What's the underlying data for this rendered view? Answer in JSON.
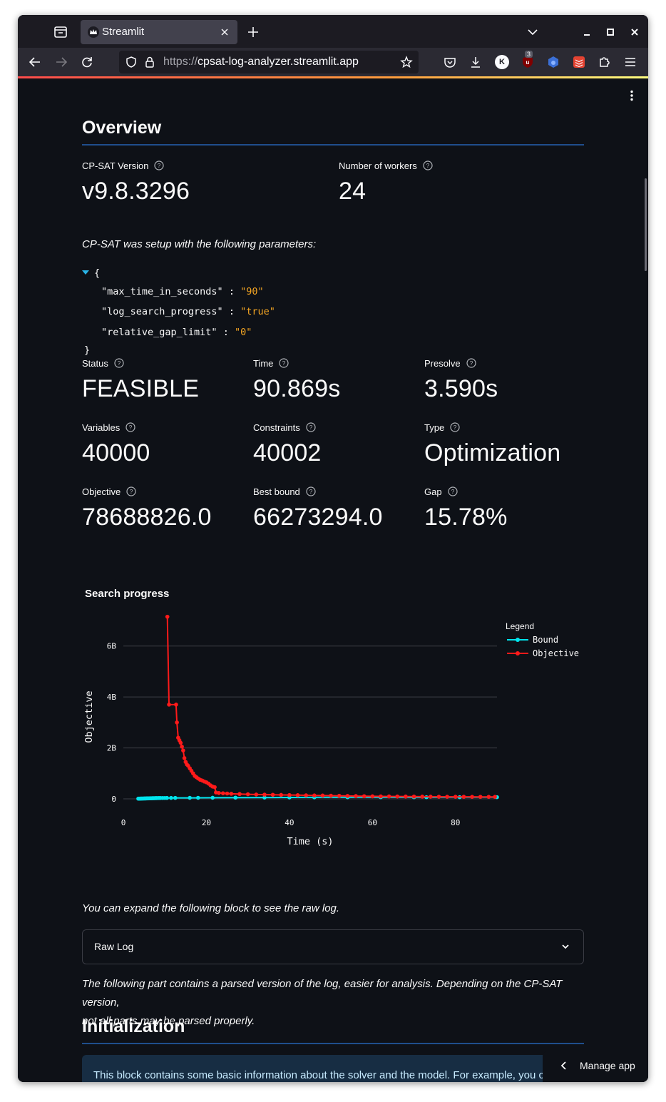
{
  "browser": {
    "tab_title": "Streamlit",
    "url_protocol": "https://",
    "url_host": "cpsat-log-analyzer.streamlit.app",
    "extension_badge": "3",
    "extension_avatar_letter": "K"
  },
  "overview": {
    "heading": "Overview",
    "version_label": "CP-SAT Version",
    "version_value": "v9.8.3296",
    "workers_label": "Number of workers",
    "workers_value": "24",
    "params_intro": "CP-SAT was setup with the following parameters:",
    "params": [
      {
        "key": "\"max_time_in_seconds\"",
        "value": "\"90\""
      },
      {
        "key": "\"log_search_progress\"",
        "value": "\"true\""
      },
      {
        "key": "\"relative_gap_limit\"",
        "value": "\"0\""
      }
    ],
    "metrics": [
      {
        "label": "Status",
        "value": "FEASIBLE"
      },
      {
        "label": "Time",
        "value": "90.869s"
      },
      {
        "label": "Presolve",
        "value": "3.590s"
      },
      {
        "label": "Variables",
        "value": "40000"
      },
      {
        "label": "Constraints",
        "value": "40002"
      },
      {
        "label": "Type",
        "value": "Optimization"
      },
      {
        "label": "Objective",
        "value": "78688826.0"
      },
      {
        "label": "Best bound",
        "value": "66273294.0"
      },
      {
        "label": "Gap",
        "value": "15.78%"
      }
    ]
  },
  "search_progress": {
    "title": "Search progress"
  },
  "chart_data": {
    "type": "line",
    "xlabel": "Time (s)",
    "ylabel": "Objective",
    "xlim": [
      0,
      90
    ],
    "ylim": [
      0,
      7000000000
    ],
    "x_ticks": [
      0,
      20,
      40,
      60,
      80
    ],
    "x_tick_labels": [
      "0",
      "20",
      "40",
      "60",
      "80"
    ],
    "y_ticks": [
      0,
      2000000000,
      4000000000,
      6000000000
    ],
    "y_tick_labels": [
      "0",
      "2B",
      "4B",
      "6B"
    ],
    "legend_title": "Legend",
    "legend_position": "top-right",
    "grid": true,
    "series": [
      {
        "name": "Bound",
        "color": "#00e5ee",
        "x": [
          3.6,
          3.8,
          4.0,
          4.2,
          4.4,
          4.6,
          4.8,
          5.0,
          5.2,
          5.4,
          5.6,
          5.8,
          6.0,
          6.2,
          6.4,
          6.6,
          6.8,
          7.0,
          7.2,
          7.4,
          7.6,
          7.8,
          8.0,
          8.3,
          8.6,
          9.0,
          9.5,
          10.0,
          10.5,
          11.5,
          12.5,
          16.0,
          18.0,
          21.5,
          27.0,
          34.0,
          40.0,
          46.0,
          54.0,
          62.0,
          70.0,
          73.0,
          81.0,
          90.0
        ],
        "y": [
          8000000,
          9000000,
          10000000,
          11000000,
          12000000,
          13000000,
          14000000,
          15000000,
          16000000,
          17000000,
          18000000,
          19000000,
          20000000,
          21000000,
          22000000,
          23000000,
          24000000,
          25000000,
          26000000,
          27000000,
          28000000,
          29000000,
          30000000,
          31000000,
          32000000,
          33000000,
          34000000,
          35000000,
          36000000,
          37000000,
          38000000,
          40000000,
          42000000,
          44000000,
          48000000,
          52000000,
          55000000,
          58000000,
          61000000,
          63000000,
          64000000,
          65000000,
          66000000,
          66273294
        ]
      },
      {
        "name": "Objective",
        "color": "#ff1a1a",
        "x": [
          10.6,
          11.0,
          12.7,
          12.9,
          13.2,
          13.5,
          13.8,
          14.1,
          14.4,
          14.7,
          15.0,
          15.3,
          15.6,
          16.0,
          16.4,
          16.8,
          17.2,
          17.6,
          18.0,
          18.5,
          19.0,
          19.5,
          20.0,
          20.5,
          21.0,
          21.5,
          22.0,
          22.3,
          23.0,
          24.0,
          25.0,
          26.0,
          28.0,
          30.0,
          32.0,
          34.0,
          36.0,
          38.0,
          40.0,
          42.0,
          44.0,
          46.0,
          48.0,
          50.0,
          52.0,
          54.0,
          56.0,
          58.0,
          60.0,
          62.0,
          64.0,
          66.0,
          68.0,
          70.0,
          72.0,
          74.0,
          76.0,
          78.0,
          80.0,
          82.0,
          84.0,
          86.0,
          88.0,
          89.5
        ],
        "y": [
          7150000000,
          3700000000,
          3700000000,
          3000000000,
          2400000000,
          2300000000,
          2200000000,
          2050000000,
          1900000000,
          1600000000,
          1450000000,
          1350000000,
          1300000000,
          1200000000,
          1100000000,
          1000000000,
          900000000,
          850000000,
          800000000,
          750000000,
          720000000,
          680000000,
          650000000,
          600000000,
          530000000,
          480000000,
          460000000,
          250000000,
          230000000,
          220000000,
          210000000,
          200000000,
          190000000,
          180000000,
          170000000,
          165000000,
          160000000,
          155000000,
          150000000,
          145000000,
          140000000,
          135000000,
          130000000,
          125000000,
          120000000,
          115000000,
          110000000,
          105000000,
          100000000,
          98000000,
          96000000,
          94000000,
          92000000,
          90000000,
          88000000,
          86000000,
          84000000,
          83000000,
          82000000,
          81000000,
          80000000,
          79500000,
          79000000,
          78688826
        ]
      }
    ]
  },
  "raw_log": {
    "intro": "You can expand the following block to see the raw log.",
    "label": "Raw Log"
  },
  "parsed": {
    "intro_line1": "The following part contains a parsed version of the log, easier for analysis. Depending on the CP-SAT version,",
    "intro_line2": "not all parts may be parsed properly."
  },
  "initialization": {
    "heading": "Initialization",
    "info": "This block contains some basic information about the solver and the model. For example, you c"
  },
  "manage_app": {
    "label": "Manage app"
  }
}
